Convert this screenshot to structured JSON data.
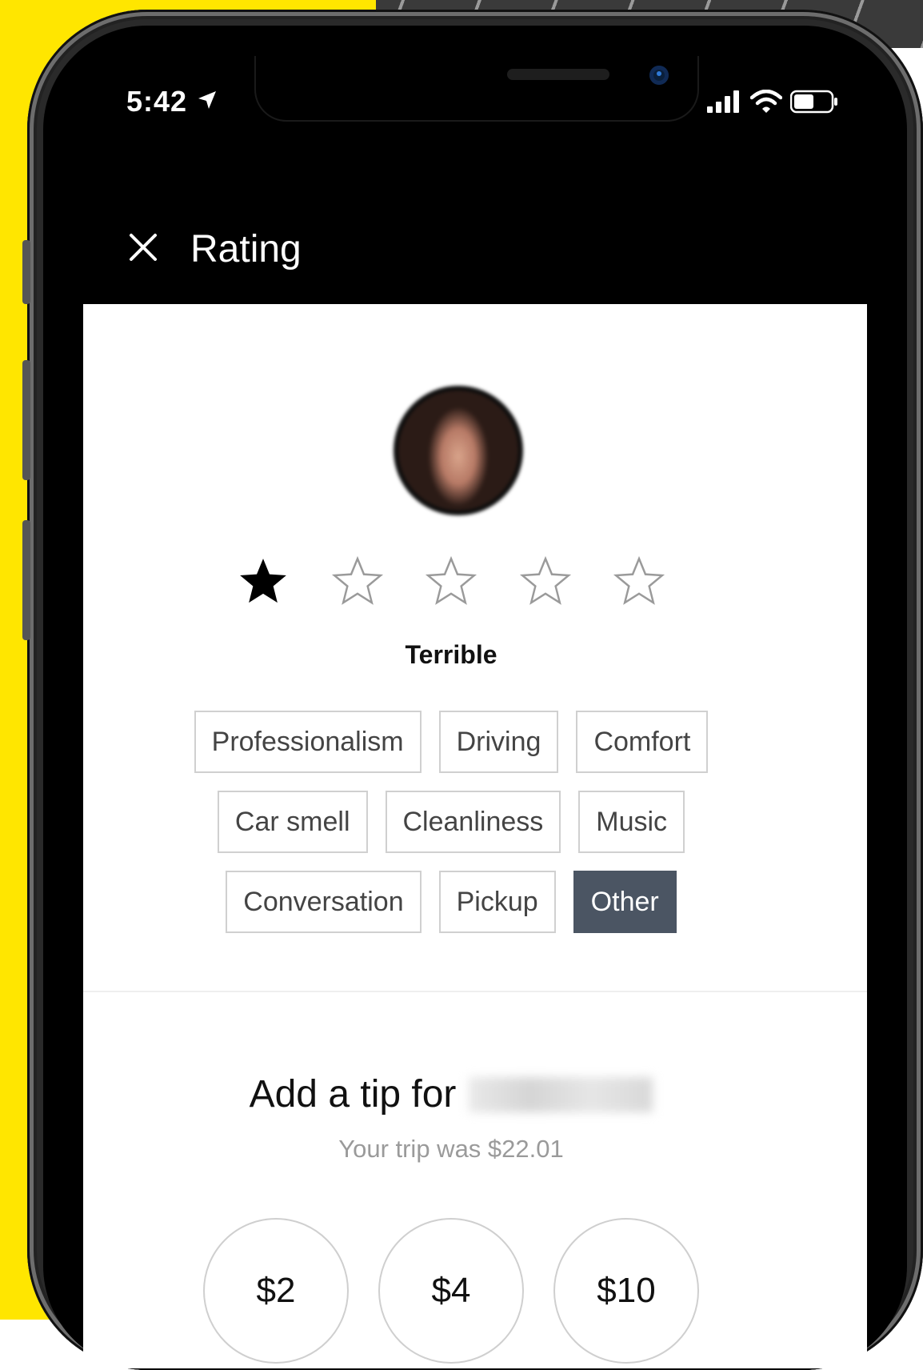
{
  "status_bar": {
    "time": "5:42"
  },
  "header": {
    "title": "Rating"
  },
  "rating": {
    "stars_filled": 1,
    "stars_total": 5,
    "label": "Terrible"
  },
  "feedback_chips": [
    [
      "Professionalism",
      "Driving",
      "Comfort"
    ],
    [
      "Car smell",
      "Cleanliness",
      "Music"
    ],
    [
      "Conversation",
      "Pickup",
      "Other"
    ]
  ],
  "selected_chip": "Other",
  "tip": {
    "title": "Add a tip for",
    "trip_total": "Your trip was $22.01",
    "options": [
      "$2",
      "$4",
      "$10"
    ]
  },
  "colors": {
    "background_accent": "#ffe600",
    "header_bg": "#000000",
    "selected_chip_bg": "#4b5563"
  }
}
